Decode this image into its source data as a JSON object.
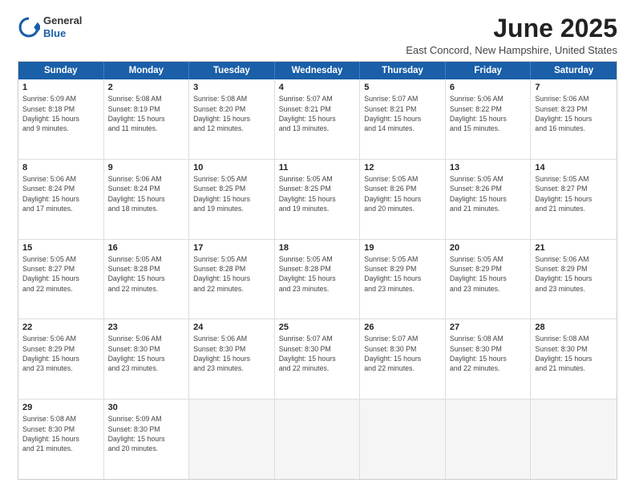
{
  "logo": {
    "general": "General",
    "blue": "Blue"
  },
  "title": {
    "month": "June 2025",
    "location": "East Concord, New Hampshire, United States"
  },
  "header_days": [
    "Sunday",
    "Monday",
    "Tuesday",
    "Wednesday",
    "Thursday",
    "Friday",
    "Saturday"
  ],
  "weeks": [
    [
      {
        "day": "1",
        "lines": [
          "Sunrise: 5:09 AM",
          "Sunset: 8:18 PM",
          "Daylight: 15 hours",
          "and 9 minutes."
        ]
      },
      {
        "day": "2",
        "lines": [
          "Sunrise: 5:08 AM",
          "Sunset: 8:19 PM",
          "Daylight: 15 hours",
          "and 11 minutes."
        ]
      },
      {
        "day": "3",
        "lines": [
          "Sunrise: 5:08 AM",
          "Sunset: 8:20 PM",
          "Daylight: 15 hours",
          "and 12 minutes."
        ]
      },
      {
        "day": "4",
        "lines": [
          "Sunrise: 5:07 AM",
          "Sunset: 8:21 PM",
          "Daylight: 15 hours",
          "and 13 minutes."
        ]
      },
      {
        "day": "5",
        "lines": [
          "Sunrise: 5:07 AM",
          "Sunset: 8:21 PM",
          "Daylight: 15 hours",
          "and 14 minutes."
        ]
      },
      {
        "day": "6",
        "lines": [
          "Sunrise: 5:06 AM",
          "Sunset: 8:22 PM",
          "Daylight: 15 hours",
          "and 15 minutes."
        ]
      },
      {
        "day": "7",
        "lines": [
          "Sunrise: 5:06 AM",
          "Sunset: 8:23 PM",
          "Daylight: 15 hours",
          "and 16 minutes."
        ]
      }
    ],
    [
      {
        "day": "8",
        "lines": [
          "Sunrise: 5:06 AM",
          "Sunset: 8:24 PM",
          "Daylight: 15 hours",
          "and 17 minutes."
        ]
      },
      {
        "day": "9",
        "lines": [
          "Sunrise: 5:06 AM",
          "Sunset: 8:24 PM",
          "Daylight: 15 hours",
          "and 18 minutes."
        ]
      },
      {
        "day": "10",
        "lines": [
          "Sunrise: 5:05 AM",
          "Sunset: 8:25 PM",
          "Daylight: 15 hours",
          "and 19 minutes."
        ]
      },
      {
        "day": "11",
        "lines": [
          "Sunrise: 5:05 AM",
          "Sunset: 8:25 PM",
          "Daylight: 15 hours",
          "and 19 minutes."
        ]
      },
      {
        "day": "12",
        "lines": [
          "Sunrise: 5:05 AM",
          "Sunset: 8:26 PM",
          "Daylight: 15 hours",
          "and 20 minutes."
        ]
      },
      {
        "day": "13",
        "lines": [
          "Sunrise: 5:05 AM",
          "Sunset: 8:26 PM",
          "Daylight: 15 hours",
          "and 21 minutes."
        ]
      },
      {
        "day": "14",
        "lines": [
          "Sunrise: 5:05 AM",
          "Sunset: 8:27 PM",
          "Daylight: 15 hours",
          "and 21 minutes."
        ]
      }
    ],
    [
      {
        "day": "15",
        "lines": [
          "Sunrise: 5:05 AM",
          "Sunset: 8:27 PM",
          "Daylight: 15 hours",
          "and 22 minutes."
        ]
      },
      {
        "day": "16",
        "lines": [
          "Sunrise: 5:05 AM",
          "Sunset: 8:28 PM",
          "Daylight: 15 hours",
          "and 22 minutes."
        ]
      },
      {
        "day": "17",
        "lines": [
          "Sunrise: 5:05 AM",
          "Sunset: 8:28 PM",
          "Daylight: 15 hours",
          "and 22 minutes."
        ]
      },
      {
        "day": "18",
        "lines": [
          "Sunrise: 5:05 AM",
          "Sunset: 8:28 PM",
          "Daylight: 15 hours",
          "and 23 minutes."
        ]
      },
      {
        "day": "19",
        "lines": [
          "Sunrise: 5:05 AM",
          "Sunset: 8:29 PM",
          "Daylight: 15 hours",
          "and 23 minutes."
        ]
      },
      {
        "day": "20",
        "lines": [
          "Sunrise: 5:05 AM",
          "Sunset: 8:29 PM",
          "Daylight: 15 hours",
          "and 23 minutes."
        ]
      },
      {
        "day": "21",
        "lines": [
          "Sunrise: 5:06 AM",
          "Sunset: 8:29 PM",
          "Daylight: 15 hours",
          "and 23 minutes."
        ]
      }
    ],
    [
      {
        "day": "22",
        "lines": [
          "Sunrise: 5:06 AM",
          "Sunset: 8:29 PM",
          "Daylight: 15 hours",
          "and 23 minutes."
        ]
      },
      {
        "day": "23",
        "lines": [
          "Sunrise: 5:06 AM",
          "Sunset: 8:30 PM",
          "Daylight: 15 hours",
          "and 23 minutes."
        ]
      },
      {
        "day": "24",
        "lines": [
          "Sunrise: 5:06 AM",
          "Sunset: 8:30 PM",
          "Daylight: 15 hours",
          "and 23 minutes."
        ]
      },
      {
        "day": "25",
        "lines": [
          "Sunrise: 5:07 AM",
          "Sunset: 8:30 PM",
          "Daylight: 15 hours",
          "and 22 minutes."
        ]
      },
      {
        "day": "26",
        "lines": [
          "Sunrise: 5:07 AM",
          "Sunset: 8:30 PM",
          "Daylight: 15 hours",
          "and 22 minutes."
        ]
      },
      {
        "day": "27",
        "lines": [
          "Sunrise: 5:08 AM",
          "Sunset: 8:30 PM",
          "Daylight: 15 hours",
          "and 22 minutes."
        ]
      },
      {
        "day": "28",
        "lines": [
          "Sunrise: 5:08 AM",
          "Sunset: 8:30 PM",
          "Daylight: 15 hours",
          "and 21 minutes."
        ]
      }
    ],
    [
      {
        "day": "29",
        "lines": [
          "Sunrise: 5:08 AM",
          "Sunset: 8:30 PM",
          "Daylight: 15 hours",
          "and 21 minutes."
        ]
      },
      {
        "day": "30",
        "lines": [
          "Sunrise: 5:09 AM",
          "Sunset: 8:30 PM",
          "Daylight: 15 hours",
          "and 20 minutes."
        ]
      },
      {
        "day": "",
        "lines": []
      },
      {
        "day": "",
        "lines": []
      },
      {
        "day": "",
        "lines": []
      },
      {
        "day": "",
        "lines": []
      },
      {
        "day": "",
        "lines": []
      }
    ]
  ]
}
